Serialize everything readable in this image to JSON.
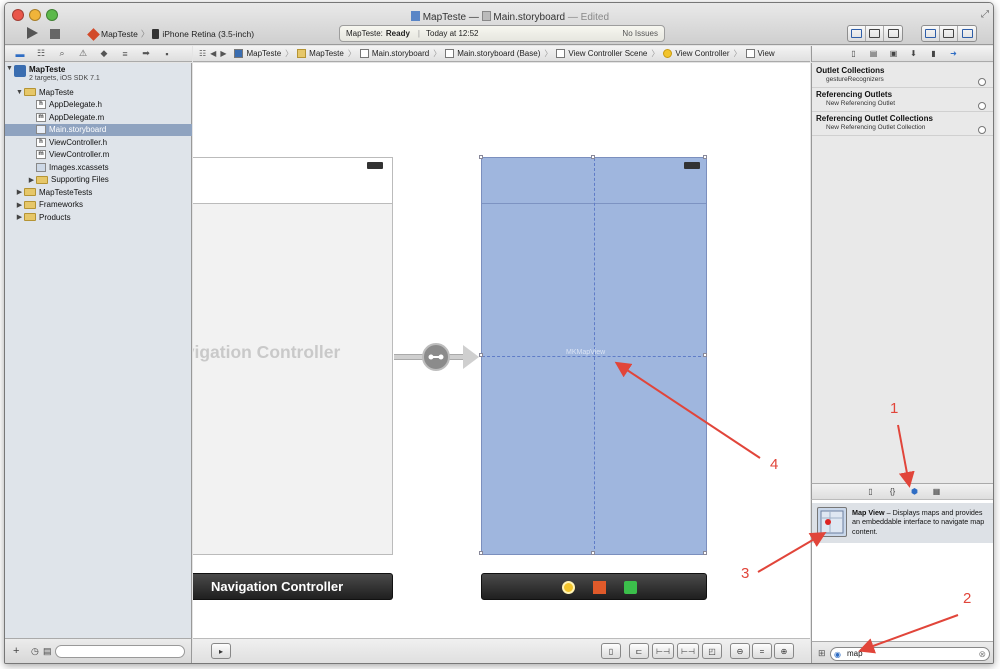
{
  "window": {
    "title_project": "MapTeste",
    "title_sep": "—",
    "title_file": "Main.storyboard",
    "title_status": "— Edited",
    "colors": {
      "accent": "#2f6dc4",
      "annotation": "#e1453a",
      "selection": "#9fb6de"
    }
  },
  "toolbar": {
    "scheme": "MapTeste",
    "destination": "iPhone Retina (3.5-inch)",
    "activity_app": "MapTeste:",
    "activity_state": "Ready",
    "activity_time": "Today at 12:52",
    "activity_issues": "No Issues"
  },
  "navigator": {
    "icons": [
      "folder-icon",
      "hierarchy-icon",
      "search-icon",
      "warning-icon",
      "test-icon",
      "breakpoint-icon",
      "log-icon"
    ],
    "items": [
      {
        "label": "MapTeste",
        "sublabel": "2 targets, iOS SDK 7.1",
        "kind": "project",
        "depth": 0
      },
      {
        "label": "MapTeste",
        "kind": "folder",
        "depth": 1
      },
      {
        "label": "AppDelegate.h",
        "kind": "h",
        "depth": 2
      },
      {
        "label": "AppDelegate.m",
        "kind": "m",
        "depth": 2
      },
      {
        "label": "Main.storyboard",
        "kind": "storyboard",
        "depth": 2,
        "selected": true
      },
      {
        "label": "ViewController.h",
        "kind": "h",
        "depth": 2
      },
      {
        "label": "ViewController.m",
        "kind": "m",
        "depth": 2
      },
      {
        "label": "Images.xcassets",
        "kind": "assets",
        "depth": 2
      },
      {
        "label": "Supporting Files",
        "kind": "folder",
        "depth": 2
      },
      {
        "label": "MapTesteTests",
        "kind": "folder",
        "depth": 1
      },
      {
        "label": "Frameworks",
        "kind": "folder",
        "depth": 1
      },
      {
        "label": "Products",
        "kind": "folder",
        "depth": 1
      }
    ]
  },
  "jumpbar": {
    "crumbs": [
      "MapTeste",
      "MapTeste",
      "Main.storyboard",
      "Main.storyboard (Base)",
      "View Controller Scene",
      "View Controller",
      "View"
    ]
  },
  "canvas": {
    "nav_controller_title": "avigation Controller",
    "nav_controller_dock": "Navigation Controller",
    "mapview_label": "MKMapView"
  },
  "inspector": {
    "sections": [
      {
        "heading": "Outlet Collections",
        "rows": [
          "gestureRecognizers"
        ]
      },
      {
        "heading": "Referencing Outlets",
        "rows": [
          "New Referencing Outlet"
        ]
      },
      {
        "heading": "Referencing Outlet Collections",
        "rows": [
          "New Referencing Outlet Collection"
        ]
      }
    ]
  },
  "library": {
    "item_title": "Map View",
    "item_desc": " – Displays maps and provides an embeddable interface to navigate map content.",
    "filter_value": "map"
  },
  "annotations": [
    "1",
    "2",
    "3",
    "4"
  ]
}
